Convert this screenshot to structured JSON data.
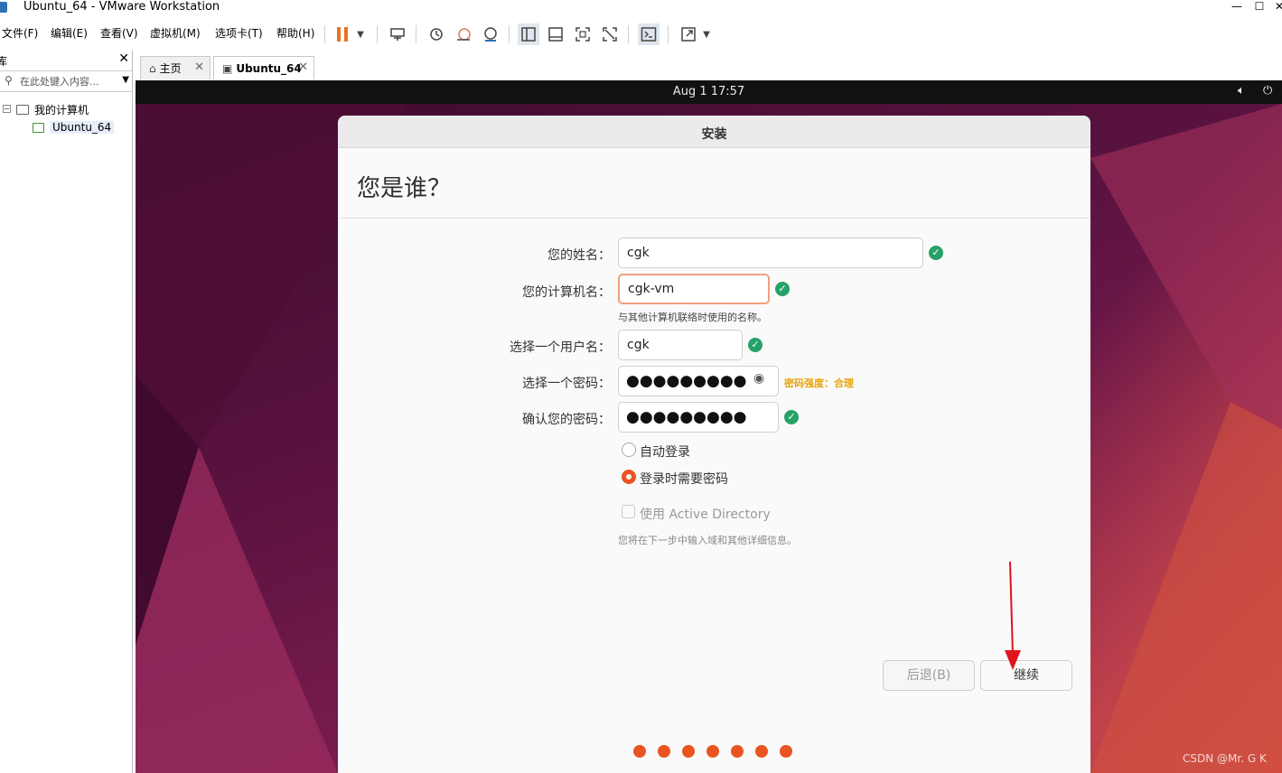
{
  "window": {
    "title": "Ubuntu_64 - VMware Workstation",
    "controls": {
      "minimize": "—",
      "maximize": "☐",
      "close": "✕"
    }
  },
  "menu": {
    "items": [
      "文件(F)",
      "编辑(E)",
      "查看(V)",
      "虚拟机(M)",
      "选项卡(T)",
      "帮助(H)"
    ]
  },
  "toolbar": {
    "icons": [
      "pause-icon",
      "send-keys-icon",
      "snapshot-icon",
      "revert-snapshot-icon",
      "manage-snapshots-icon",
      "library-view-icon",
      "console-view-icon",
      "full-screen-icon",
      "unity-icon",
      "terminal-icon",
      "stretch-icon"
    ]
  },
  "library": {
    "title": "库",
    "close": "✕",
    "search_placeholder": "在此处键入内容...",
    "tree": {
      "root": "我的计算机",
      "vm": "Ubuntu_64"
    }
  },
  "tabs": [
    {
      "label": "主页",
      "active": false
    },
    {
      "label": "Ubuntu_64",
      "active": true
    }
  ],
  "guest": {
    "clock": "Aug 1  17:57"
  },
  "installer": {
    "title": "安装",
    "heading": "您是谁？",
    "fields": {
      "name": {
        "label": "您的姓名：",
        "value": "cgk"
      },
      "computer": {
        "label": "您的计算机名：",
        "value": "cgk-vm",
        "hint": "与其他计算机联络时使用的名称。"
      },
      "username": {
        "label": "选择一个用户名：",
        "value": "cgk"
      },
      "password": {
        "label": "选择一个密码：",
        "value": "●●●●●●●●●",
        "strength": "密码强度：合理"
      },
      "confirm": {
        "label": "确认您的密码：",
        "value": "●●●●●●●●●"
      }
    },
    "login_options": {
      "auto": "自动登录",
      "require_password": "登录时需要密码",
      "selected": "require_password"
    },
    "active_directory": {
      "label": "使用 Active Directory",
      "hint": "您将在下一步中输入域和其他详细信息。"
    },
    "buttons": {
      "back": "后退(B)",
      "continue": "继续"
    },
    "progress_steps": 7
  },
  "watermark": "CSDN @Mr. G K",
  "colors": {
    "ubuntu_orange": "#e95420",
    "check_green": "#26a269",
    "strength_amber": "#e5a50a",
    "annotation_red": "#e0141e"
  }
}
